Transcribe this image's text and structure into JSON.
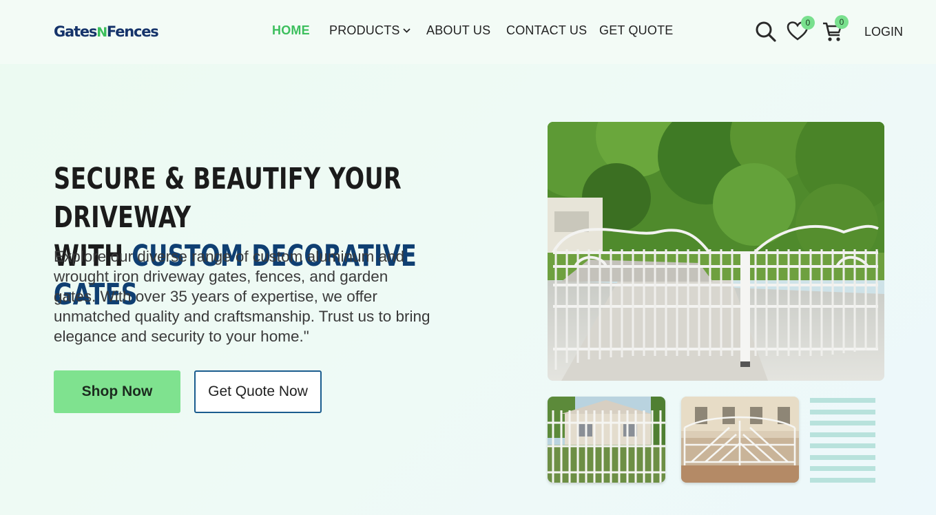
{
  "header": {
    "logo_part1": "Gates",
    "logo_part2": "N",
    "logo_part3": "Fences",
    "nav": [
      {
        "label": "HOME",
        "active": true
      },
      {
        "label": "PRODUCTS",
        "has_dropdown": true
      },
      {
        "label": "ABOUT US"
      },
      {
        "label": "CONTACT US"
      },
      {
        "label": "GET QUOTE"
      }
    ],
    "wishlist_count": "0",
    "cart_count": "0",
    "login_label": "LOGIN",
    "icons": [
      "search-icon",
      "heart-icon",
      "cart-icon",
      "chevron-down-icon"
    ]
  },
  "hero": {
    "title_line1": "SECURE & BEAUTIFY YOUR DRIVEWAY",
    "title_with": "WITH ",
    "title_highlight": "CUSTOM DECORATIVE GATES",
    "description": "Explore our diverse range of custom aluminum and wrought iron driveway gates, fences, and garden gates. With over 35 years of expertise, we offer unmatched quality and craftsmanship. Trust us to bring elegance and security to your home.\"",
    "shop_button": "Shop Now",
    "quote_button": "Get Quote Now"
  },
  "colors": {
    "accent_green": "#3cbf5d",
    "button_green": "#7fe28f",
    "title_blue": "#0f3f72",
    "outline_blue": "#1a5c8e"
  }
}
